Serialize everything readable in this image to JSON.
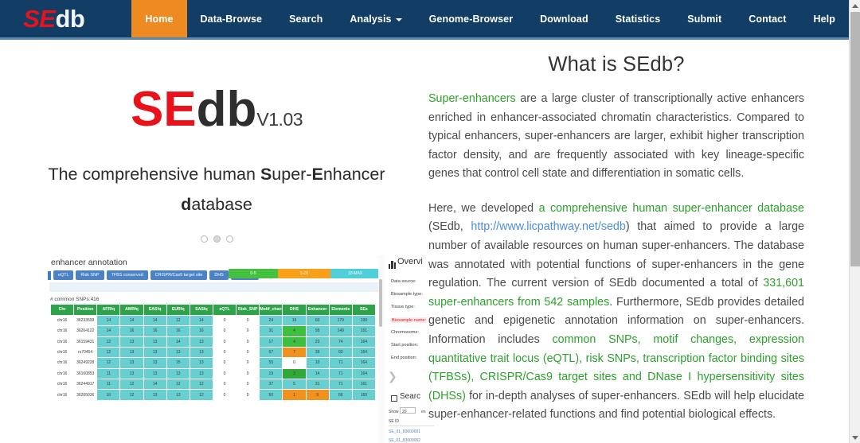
{
  "site": {
    "logo_se": "SE",
    "logo_db": "db"
  },
  "nav": {
    "items": [
      {
        "label": "Home",
        "active": true,
        "dropdown": false
      },
      {
        "label": "Data-Browse",
        "active": false,
        "dropdown": false
      },
      {
        "label": "Search",
        "active": false,
        "dropdown": false
      },
      {
        "label": "Analysis",
        "active": false,
        "dropdown": true
      },
      {
        "label": "Genome-Browser",
        "active": false,
        "dropdown": false
      },
      {
        "label": "Download",
        "active": false,
        "dropdown": false
      },
      {
        "label": "Statistics",
        "active": false,
        "dropdown": false
      },
      {
        "label": "Submit",
        "active": false,
        "dropdown": false
      },
      {
        "label": "Contact",
        "active": false,
        "dropdown": false
      },
      {
        "label": "Help",
        "active": false,
        "dropdown": false
      }
    ]
  },
  "hero": {
    "title_se": "SE",
    "title_db": "db",
    "version": "V1.03",
    "tagline_part1": "The comprehensive human ",
    "tagline_s": "S",
    "tagline_uper": "uper-",
    "tagline_e": "E",
    "tagline_nhancer": "nhancer ",
    "tagline_d": "d",
    "tagline_atabase": "atabase"
  },
  "screenshot": {
    "heading": "enhancer annotation",
    "tabs": [
      "eQTL",
      "Risk SNP",
      "TFBS conserved",
      "CRISPR/Cas9 target site",
      "DHS",
      "Enhancer"
    ],
    "legend": [
      {
        "label": "0-5",
        "color": "#45c13f"
      },
      {
        "label": "5-10",
        "color": "#f9a01b"
      },
      {
        "label": "10-MAX",
        "color": "#4fd0d8"
      }
    ],
    "snp_label": "# common SNPs:416",
    "table": {
      "columns": [
        "Chr",
        "Position",
        "AFRfq",
        "AMRfq",
        "EASfq",
        "EURfq",
        "SASfq",
        "eQTL",
        "Risk_SNP",
        "Motif_changed",
        "DHS",
        "Enhancer",
        "Elements",
        "SEs"
      ],
      "rows": [
        {
          "cells": [
            "chr16",
            "36233599",
            "14",
            "14",
            "14",
            "12",
            "14",
            "0",
            "0",
            "24",
            "19",
            "60",
            "179",
            "199"
          ],
          "styles": [
            "w",
            "w",
            "t",
            "t",
            "t",
            "t",
            "t",
            "w",
            "w",
            "t",
            "t",
            "t",
            "t",
            "t"
          ]
        },
        {
          "cells": [
            "chr16",
            "36264122",
            "14",
            "16",
            "16",
            "16",
            "16",
            "0",
            "0",
            "31",
            "4",
            "95",
            "149",
            "151"
          ],
          "styles": [
            "w",
            "w",
            "t",
            "t",
            "t",
            "t",
            "t",
            "w",
            "w",
            "t",
            "g",
            "t",
            "t",
            "t"
          ]
        },
        {
          "cells": [
            "chr16",
            "36159431",
            "12",
            "13",
            "13",
            "14",
            "13",
            "0",
            "0",
            "17",
            "4",
            "23",
            "74",
            "164"
          ],
          "styles": [
            "w",
            "w",
            "t",
            "t",
            "t",
            "t",
            "t",
            "w",
            "w",
            "t",
            "g",
            "t",
            "t",
            "t"
          ]
        },
        {
          "cells": [
            "chr16",
            "rs70454",
            "12",
            "13",
            "13",
            "13",
            "13",
            "0",
            "0",
            "67",
            "7",
            "39",
            "93",
            "164"
          ],
          "styles": [
            "w",
            "w",
            "t",
            "t",
            "t",
            "t",
            "t",
            "w",
            "w",
            "t",
            "o",
            "t",
            "t",
            "t"
          ]
        },
        {
          "cells": [
            "chr16",
            "36249228",
            "12",
            "13",
            "13",
            "15",
            "13",
            "0",
            "0",
            "55",
            "0",
            "10",
            "71",
            "164"
          ],
          "styles": [
            "w",
            "w",
            "t",
            "t",
            "t",
            "t",
            "t",
            "w",
            "w",
            "t",
            "wh",
            "t",
            "t",
            "t"
          ]
        },
        {
          "cells": [
            "chr16",
            "36160853",
            "11",
            "13",
            "13",
            "13",
            "13",
            "0",
            "0",
            "19",
            "3",
            "14",
            "71",
            "164"
          ],
          "styles": [
            "w",
            "w",
            "t",
            "t",
            "t",
            "t",
            "t",
            "w",
            "w",
            "t",
            "dg",
            "t",
            "t",
            "t"
          ]
        },
        {
          "cells": [
            "chr16",
            "36244917",
            "11",
            "12",
            "14",
            "12",
            "12",
            "0",
            "0",
            "37",
            "5",
            "31",
            "71",
            "161"
          ],
          "styles": [
            "w",
            "w",
            "t",
            "t",
            "t",
            "t",
            "t",
            "w",
            "w",
            "t",
            "t",
            "t",
            "t",
            "t"
          ]
        },
        {
          "cells": [
            "chr16",
            "36205036",
            "10",
            "12",
            "13",
            "13",
            "12",
            "0",
            "0",
            "60",
            "1",
            "9",
            "66",
            "160"
          ],
          "styles": [
            "w",
            "w",
            "t",
            "t",
            "t",
            "t",
            "t",
            "w",
            "w",
            "t",
            "o",
            "o",
            "t",
            "t"
          ]
        }
      ]
    },
    "overview": {
      "title": "Overvi",
      "fields": [
        "Data source:",
        "Biosample type:",
        "Tissue type:",
        "Biosample name:",
        "Chromosome:",
        "Start position:",
        "End position:"
      ],
      "highlight_index": 3
    },
    "search": {
      "title": "Searc",
      "show_label": "Show",
      "show_value": "20",
      "entries_label": "en",
      "column": "SE ID",
      "rows": [
        "SE_01_83000001",
        "SE_01_83000002"
      ]
    },
    "carousel_dots": 3,
    "carousel_active": 1
  },
  "about": {
    "title": "What is SEdb?",
    "p1": [
      {
        "t": "Super-enhancers",
        "s": "green"
      },
      {
        "t": " are a large cluster of transcriptionally active enhancers enriched in enhancer-associated chromatin characteristics. Compared to typical enhancers, super-enhancers are larger, exhibit higher transcription factor density, and are frequently associated with key lineage-specific genes that control cell state and differentiation in somatic cells.",
        "s": "plain"
      }
    ],
    "p2": [
      {
        "t": "Here, we developed ",
        "s": "plain"
      },
      {
        "t": "a comprehensive human super-enhancer database",
        "s": "green"
      },
      {
        "t": " (SEdb, ",
        "s": "plain"
      },
      {
        "t": "http://www.licpathway.net/sedb",
        "s": "link"
      },
      {
        "t": ") that aimed to provide a large number of available resources on human super-enhancers. The database was annotated with potential functions of super-enhancers in the gene regulation. The current version of SEdb documented a total of ",
        "s": "plain"
      },
      {
        "t": "331,601 super-enhancers from 542 samples",
        "s": "green"
      },
      {
        "t": ". Furthermore, SEdb provides detailed genetic and epigenetic annotation information on super-enhancers. Information includes ",
        "s": "plain"
      },
      {
        "t": "common SNPs, motif changes, expression quantitative trait locus (eQTL), risk SNPs, transcription factor binding sites (TFBSs), CRISPR/Cas9 target sites and DNase I hypersensitivity sites (DHSs)",
        "s": "green"
      },
      {
        "t": " for in-depth analyses of super-enhancers. SEdb will help elucidate super-enhancer-related functions and find potential biological effects.",
        "s": "plain"
      }
    ]
  },
  "colors": {
    "nav_bg": "#123E66",
    "nav_active": "#ED8B22",
    "brand_red": "#E8131A",
    "highlight_green": "#2DA12D",
    "link_blue": "#4a90d9"
  }
}
